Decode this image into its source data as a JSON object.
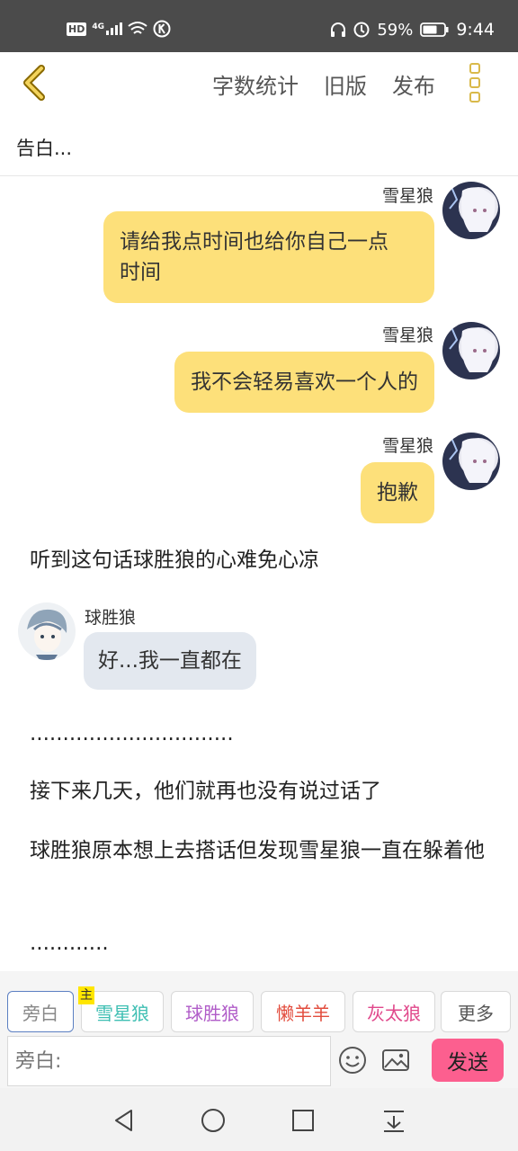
{
  "status": {
    "left_icons": [
      "hd-icon",
      "4g-signal-icon",
      "wifi-icon",
      "k-badge-icon"
    ],
    "hd_label": "HD",
    "net_label": "4G",
    "battery_percent": "59%",
    "time": "9:44"
  },
  "topbar": {
    "links": [
      "字数统计",
      "旧版",
      "发布"
    ]
  },
  "title": "告白...",
  "messages": [
    {
      "speaker": "雪星狼",
      "text_lines": [
        "请给我点时间也给你自己一点",
        "时间"
      ]
    },
    {
      "speaker": "雪星狼",
      "text": "我不会轻易喜欢一个人的"
    },
    {
      "speaker": "雪星狼",
      "text": "抱歉"
    }
  ],
  "narration1": "听到这句话球胜狼的心难免心凉",
  "reply": {
    "speaker": "球胜狼",
    "text": "好...我一直都在"
  },
  "narration2": "...............................",
  "narration3": "接下来几天，他们就再也没有说过话了",
  "narration4": "球胜狼原本想上去搭话但发现雪星狼一直在躲着他",
  "narration5": "............",
  "roles": [
    {
      "label": "旁白",
      "color": "#888888"
    },
    {
      "label": "雪星狼",
      "color": "#3fbfb3",
      "tag": "主"
    },
    {
      "label": "球胜狼",
      "color": "#b05cc8"
    },
    {
      "label": "懒羊羊",
      "color": "#e24c3d"
    },
    {
      "label": "灰太狼",
      "color": "#e0488b"
    },
    {
      "label": "更多",
      "color": "#555555"
    }
  ],
  "input": {
    "placeholder": "旁白:"
  },
  "send_label": "发送",
  "colors": {
    "accent_yellow": "#fde07a",
    "send_pink": "#fc5f8f",
    "reply_bubble": "#e3e8ef"
  }
}
